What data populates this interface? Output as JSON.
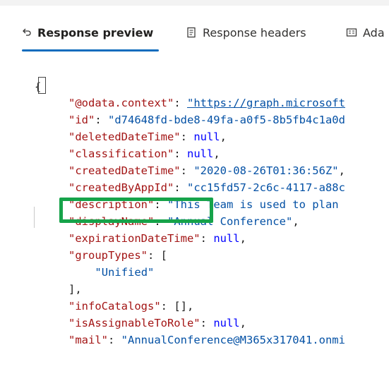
{
  "tabs": [
    {
      "label": "Response preview",
      "icon": "undo-arrow-icon",
      "active": true
    },
    {
      "label": "Response headers",
      "icon": "document-icon",
      "active": false
    },
    {
      "label": "Ada",
      "icon": "card-icon",
      "active": false
    }
  ],
  "code": {
    "open_brace": "{",
    "lines": [
      {
        "key": "\"@odata.context\"",
        "sep": ": ",
        "val": "\"https://graph.microsoft",
        "type": "url"
      },
      {
        "key": "\"id\"",
        "sep": ": ",
        "val": "\"d74648fd-bde8-49fa-a0f5-8b5fb4c1a0d",
        "type": "str"
      },
      {
        "key": "\"deletedDateTime\"",
        "sep": ": ",
        "val": "null",
        "type": "kw",
        "trail": ","
      },
      {
        "key": "\"classification\"",
        "sep": ": ",
        "val": "null",
        "type": "kw",
        "trail": ","
      },
      {
        "key": "\"createdDateTime\"",
        "sep": ": ",
        "val": "\"2020-08-26T01:36:56Z\"",
        "type": "str",
        "trail": ","
      },
      {
        "key": "\"createdByAppId\"",
        "sep": ": ",
        "val": "\"cc15fd57-2c6c-4117-a88c",
        "type": "str"
      },
      {
        "key": "\"description\"",
        "sep": ": ",
        "val": "\"This Team is used to plan",
        "type": "str"
      },
      {
        "key": "\"displayName\"",
        "sep": ": ",
        "val": "\"Annual Conference\"",
        "type": "str",
        "trail": ","
      },
      {
        "key": "\"expirationDateTime\"",
        "sep": ": ",
        "val": "null",
        "type": "kw",
        "trail": ","
      },
      {
        "key": "\"groupTypes\"",
        "sep": ": ",
        "val": "[",
        "type": "punct"
      },
      {
        "key": "",
        "sep": "",
        "val": "\"Unified\"",
        "type": "str",
        "indent": 2
      },
      {
        "key": "",
        "sep": "",
        "val": "],",
        "type": "punct"
      },
      {
        "key": "\"infoCatalogs\"",
        "sep": ": ",
        "val": "[]",
        "type": "punct",
        "trail": ","
      },
      {
        "key": "\"isAssignableToRole\"",
        "sep": ": ",
        "val": "null",
        "type": "kw",
        "trail": ","
      },
      {
        "key": "\"mail\"",
        "sep": ": ",
        "val": "\"AnnualConference@M365x317041.onmi",
        "type": "str"
      }
    ]
  },
  "highlight_color": "#16a34a"
}
